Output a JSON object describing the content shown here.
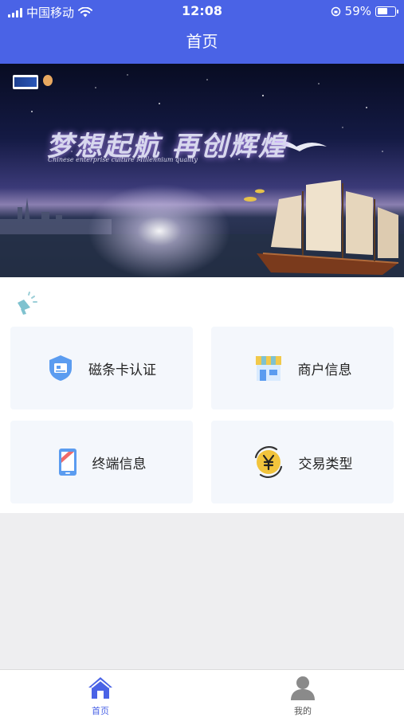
{
  "status_bar": {
    "carrier": "中国移动",
    "time": "12:08",
    "battery": "59%",
    "battery_level": 0.59
  },
  "nav": {
    "title": "首页"
  },
  "banner": {
    "headline": "梦想起航 再创辉煌",
    "subline": "Chinese enterprise culture  Millennium quality"
  },
  "menu": [
    {
      "label": "磁条卡认证",
      "icon": "shield-card-icon"
    },
    {
      "label": "商户信息",
      "icon": "store-icon"
    },
    {
      "label": "终端信息",
      "icon": "phone-icon"
    },
    {
      "label": "交易类型",
      "icon": "yen-coin-icon"
    }
  ],
  "tabs": [
    {
      "label": "首页",
      "icon": "home-icon",
      "active": true
    },
    {
      "label": "我的",
      "icon": "user-icon",
      "active": false
    }
  ],
  "colors": {
    "primary": "#4a63e6",
    "tab_active": "#4a63e6",
    "tab_inactive": "#555555"
  }
}
